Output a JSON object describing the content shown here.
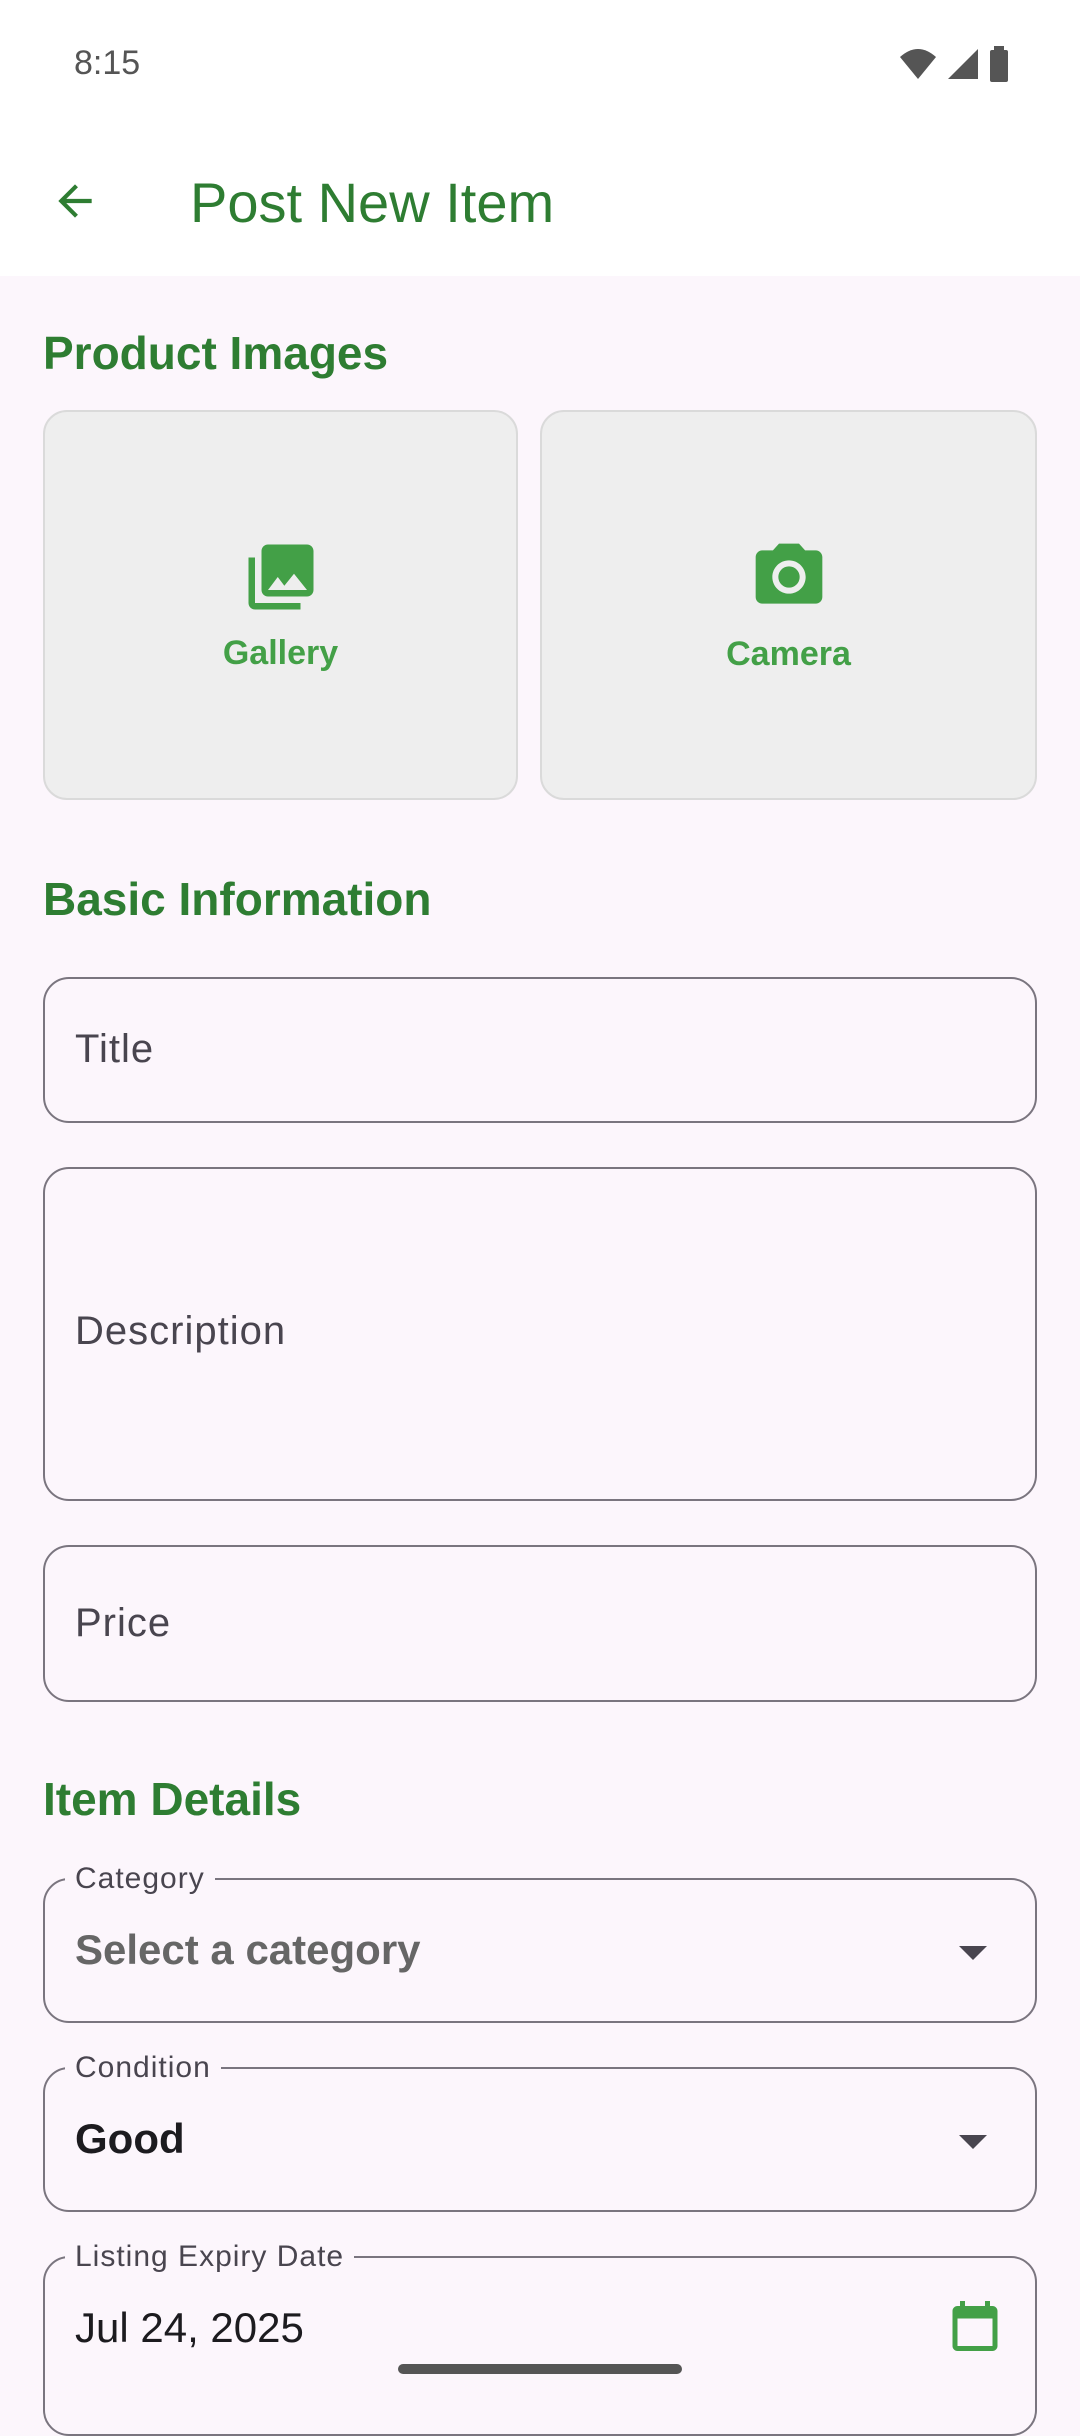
{
  "status_bar": {
    "time": "8:15"
  },
  "app_bar": {
    "title": "Post New Item"
  },
  "sections": {
    "product_images": "Product Images",
    "basic_information": "Basic Information",
    "item_details": "Item Details"
  },
  "images": {
    "gallery_label": "Gallery",
    "camera_label": "Camera"
  },
  "fields": {
    "title_placeholder": "Title",
    "description_placeholder": "Description",
    "price_placeholder": "Price",
    "category_label": "Category",
    "category_value": "Select a category",
    "condition_label": "Condition",
    "condition_value": "Good",
    "expiry_label": "Listing Expiry Date",
    "expiry_value": "Jul 24, 2025"
  },
  "colors": {
    "accent": "#2E7D32",
    "icon_green": "#43A047",
    "background": "#FCF6FC"
  }
}
